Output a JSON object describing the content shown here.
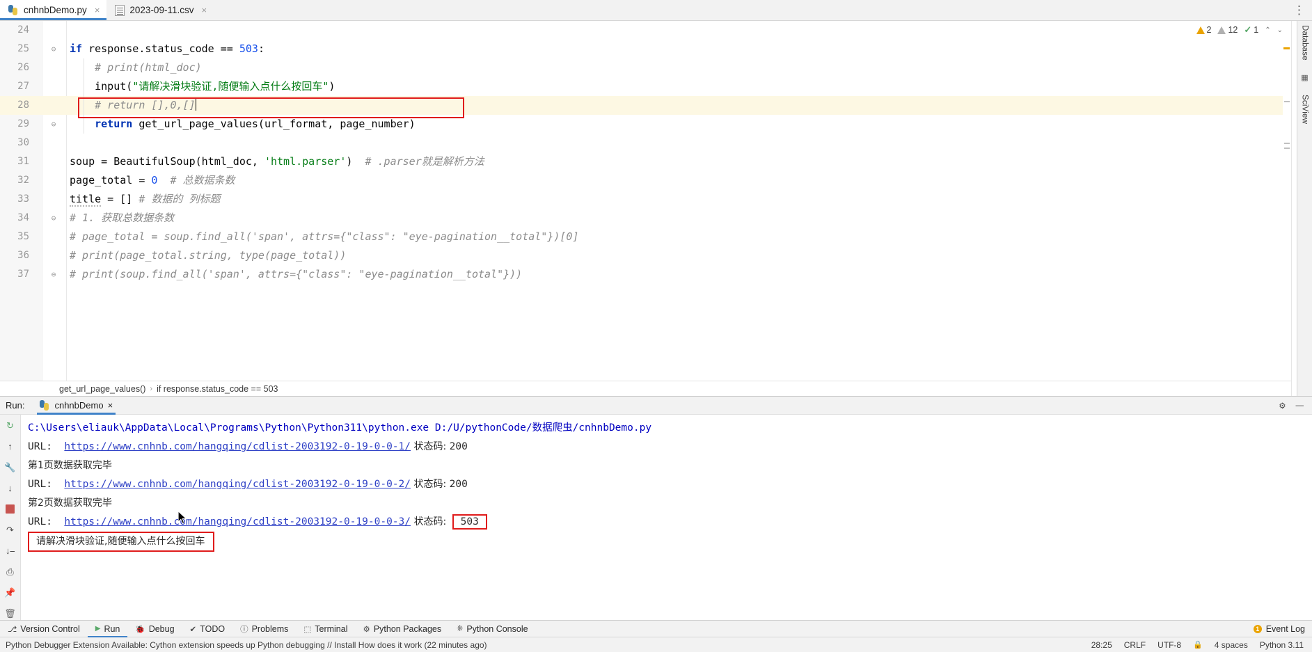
{
  "window": {
    "tabs": [
      {
        "label": "cnhnbDemo.py",
        "icon": "python-file-icon",
        "active": true,
        "close": "×"
      },
      {
        "label": "2023-09-11.csv",
        "icon": "csv-file-icon",
        "active": false,
        "close": "×"
      }
    ],
    "more_actions": "⋮"
  },
  "right_toolbar": {
    "database_label": "Database",
    "sciview_label": "SciView",
    "grid_icon": "grid-icon"
  },
  "editor": {
    "inspections": {
      "warnings": "2",
      "weak_warnings": "12",
      "checks": "1",
      "chevron_up": "⌃",
      "chevron_down": "⌄"
    },
    "lines": [
      {
        "n": "24",
        "fold": "",
        "indent": false,
        "hl": false,
        "html": ""
      },
      {
        "n": "25",
        "fold": "⊖",
        "indent": false,
        "hl": false,
        "html": "<span class=\"k\">if</span><span class=\"plain\"> response.status_code == </span><span class=\"num\">503</span><span class=\"plain\">:</span>"
      },
      {
        "n": "26",
        "fold": "",
        "indent": true,
        "hl": false,
        "html": "<span class=\"cmt\">    # print(html_doc)</span>"
      },
      {
        "n": "27",
        "fold": "",
        "indent": true,
        "hl": false,
        "html": "<span class=\"plain\">    </span><span class=\"fn\">input</span><span class=\"plain\">(</span><span class=\"str\">\"请解决滑块验证,随便输入点什么按回车\"</span><span class=\"plain\">)</span>"
      },
      {
        "n": "28",
        "fold": "",
        "indent": true,
        "hl": true,
        "html": "<span class=\"cmt\">    # return [],0,[]</span><span class=\"caret\"></span>"
      },
      {
        "n": "29",
        "fold": "⊖",
        "indent": true,
        "hl": false,
        "html": "<span class=\"plain\">    </span><span class=\"k\">return</span><span class=\"plain\"> get_url_page_values(url_format, page_number)</span>"
      },
      {
        "n": "30",
        "fold": "",
        "indent": false,
        "hl": false,
        "html": ""
      },
      {
        "n": "31",
        "fold": "",
        "indent": false,
        "hl": false,
        "html": "<span class=\"plain\">soup = BeautifulSoup(html_doc, </span><span class=\"str\">'html.parser'</span><span class=\"plain\">)</span><span class=\"cmt\">  # .parser就是解析方法</span>"
      },
      {
        "n": "32",
        "fold": "",
        "indent": false,
        "hl": false,
        "html": "<span class=\"plain\">page_total = </span><span class=\"num\">0</span><span class=\"cmt\">  # 总数据条数</span>"
      },
      {
        "n": "33",
        "fold": "",
        "indent": false,
        "hl": false,
        "html": "<span class=\"plain squiggle\">title</span><span class=\"plain\"> = []</span><span class=\"cmt\"> # 数据的 列标题</span>"
      },
      {
        "n": "34",
        "fold": "⊖",
        "indent": false,
        "hl": false,
        "html": "<span class=\"cmt\"># 1. 获取总数据条数</span>"
      },
      {
        "n": "35",
        "fold": "",
        "indent": false,
        "hl": false,
        "html": "<span class=\"cmt\"># page_total = soup.find_all('span', attrs={\"class\": \"eye-pagination__total\"})[0]</span>"
      },
      {
        "n": "36",
        "fold": "",
        "indent": false,
        "hl": false,
        "html": "<span class=\"cmt\"># print(page_total.string, type(page_total))</span>"
      },
      {
        "n": "37",
        "fold": "⊖",
        "indent": false,
        "hl": false,
        "html": "<span class=\"cmt\"># print(soup.find_all('span', attrs={\"class\": \"eye-pagination__total\"}))</span>"
      }
    ],
    "annotation_box_line": 27
  },
  "breadcrumb": {
    "items": [
      "get_url_page_values()",
      "if response.status_code == 503"
    ],
    "separator": "›"
  },
  "run_window": {
    "title": "Run:",
    "tab_label": "cnhnbDemo",
    "tab_icon": "python-run-icon",
    "tab_close": "×",
    "settings_icon": "gear-icon",
    "minimize_icon": "minimize-icon",
    "toolbar": [
      {
        "name": "rerun-button",
        "glyph": "↺"
      },
      {
        "name": "up-stack-button",
        "glyph": "↑"
      },
      {
        "name": "settings-wrench-button",
        "glyph": "ὒ7"
      },
      {
        "name": "down-stack-button",
        "glyph": "↓"
      },
      {
        "name": "stop-button",
        "glyph": ""
      },
      {
        "name": "soft-wrap-button",
        "glyph": "↵"
      },
      {
        "name": "scroll-to-end-button",
        "glyph": "⤓"
      },
      {
        "name": "print-button",
        "glyph": "⎙"
      },
      {
        "name": "pin-button",
        "glyph": "↯"
      },
      {
        "name": "clear-all-button",
        "glyph": "Ὕ1"
      }
    ],
    "console": {
      "command": "C:\\Users\\eliauk\\AppData\\Local\\Programs\\Python\\Python311\\python.exe D:/U/pythonCode/数据爬虫/cnhnbDemo.py",
      "rows": [
        {
          "type": "url",
          "prefix": "URL:  ",
          "link": "https://www.cnhnb.com/hangqing/cdlist-2003192-0-19-0-0-1/",
          "suffix_label": " 状态码: ",
          "status": "200",
          "status_boxed": false
        },
        {
          "type": "text",
          "text": "第1页数据获取完毕"
        },
        {
          "type": "url",
          "prefix": "URL:  ",
          "link": "https://www.cnhnb.com/hangqing/cdlist-2003192-0-19-0-0-2/",
          "suffix_label": " 状态码: ",
          "status": "200",
          "status_boxed": false
        },
        {
          "type": "text",
          "text": "第2页数据获取完毕"
        },
        {
          "type": "url",
          "prefix": "URL:  ",
          "link": "https://www.cnhnb.com/hangqing/cdlist-2003192-0-19-0-0-3/",
          "suffix_label": " 状态码: ",
          "status": "503",
          "status_boxed": true
        },
        {
          "type": "prompt",
          "text": "请解决滑块验证,随便输入点什么按回车",
          "boxed": true
        }
      ]
    }
  },
  "bottom_bar": {
    "items": [
      {
        "label": "Version Control",
        "icon": "branch-icon",
        "active": false
      },
      {
        "label": "Run",
        "icon": "run-icon",
        "active": true
      },
      {
        "label": "Debug",
        "icon": "debug-icon",
        "active": false
      },
      {
        "label": "TODO",
        "icon": "todo-icon",
        "active": false
      },
      {
        "label": "Problems",
        "icon": "problems-icon",
        "active": false
      },
      {
        "label": "Terminal",
        "icon": "terminal-icon",
        "active": false
      },
      {
        "label": "Python Packages",
        "icon": "packages-icon",
        "active": false
      },
      {
        "label": "Python Console",
        "icon": "python-console-icon",
        "active": false
      }
    ],
    "event_log": {
      "label": "Event Log",
      "icon": "warning-icon",
      "badge": "1"
    }
  },
  "status_bar": {
    "message": "Python Debugger Extension Available: Cython extension speeds up Python debugging // Install  How does it work (22 minutes ago)",
    "right": [
      "28:25",
      "CRLF",
      "UTF-8",
      "4 spaces",
      "Python 3.11"
    ],
    "lock_icon": "lock-icon"
  },
  "colors": {
    "accent": "#4083c9",
    "annotation_red": "#e01b1b",
    "keyword_blue": "#0033b3",
    "string_green": "#067d17",
    "comment_grey": "#8c8c8c",
    "link_blue": "#2f41c6",
    "warn_orange": "#eaa300",
    "ok_green": "#59a869",
    "stop_red": "#c75450"
  }
}
